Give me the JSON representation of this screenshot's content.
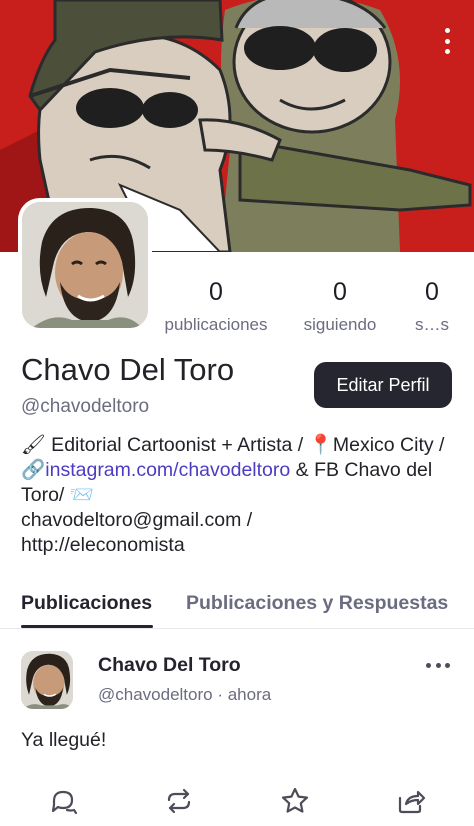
{
  "banner": {
    "description_icon": "kebab-menu-icon"
  },
  "profile": {
    "display_name": "Chavo Del Toro",
    "handle": "@chavodeltoro",
    "edit_button_label": "Editar Perfil",
    "stats": [
      {
        "value": "0",
        "label": "publicaciones"
      },
      {
        "value": "0",
        "label": "siguiendo"
      },
      {
        "value": "0",
        "label": "s…s"
      }
    ],
    "bio": {
      "line1_prefix_emoji": "🖌",
      "line1": " Editorial Cartoonist + Artista / ",
      "pin_emoji": "📍",
      "location": "Mexico City / ",
      "link_emoji": "🔗",
      "link_text": "instagram.com/chavodeltoro",
      "after_link": " & FB Chavo del Toro/ ",
      "mail_emoji": "📨",
      "email_line": "chavodeltoro@gmail.com /",
      "url_line": "http://eleconomista"
    }
  },
  "tabs": [
    {
      "label": "Publicaciones",
      "active": true
    },
    {
      "label": "Publicaciones y Respuestas",
      "active": false
    }
  ],
  "post": {
    "author": "Chavo Del Toro",
    "handle": "@chavodeltoro",
    "separator": " · ",
    "time": "ahora",
    "text": "Ya llegué!",
    "actions": [
      "reply-icon",
      "repost-icon",
      "favorite-star-icon",
      "share-icon"
    ]
  },
  "colors": {
    "banner_red": "#d6231f",
    "button_dark": "#262631",
    "link": "#4b3cc4",
    "muted": "#6b6c80"
  }
}
